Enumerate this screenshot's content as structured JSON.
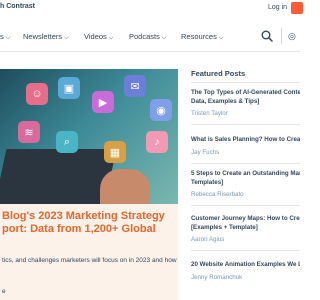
{
  "topbar": {
    "contrast_label": "h Contrast",
    "login_label": "Log in"
  },
  "nav": {
    "items": [
      {
        "label": "s"
      },
      {
        "label": "Newsletters"
      },
      {
        "label": "Videos"
      },
      {
        "label": "Podcasts"
      },
      {
        "label": "Resources"
      }
    ],
    "chevron": "⌵"
  },
  "article": {
    "title": "Blog's 2023 Marketing Strategy port: Data from 1,200+ Global",
    "description": "tics, and challenges marketers will focus on in 2023 and how",
    "more": "e"
  },
  "featured": {
    "heading": "Featured Posts",
    "posts": [
      {
        "title": "The Top Types of AI-Generated Conte",
        "title2": "Data, Examples & Tips]",
        "author": "Tristen Taylor"
      },
      {
        "title": "What is Sales Planning? How to Creat",
        "title2": "",
        "author": "Jay Fuchs"
      },
      {
        "title": "5 Steps to Create an Outstanding Mar",
        "title2": "Templates]",
        "author": "Rebecca Riserbato"
      },
      {
        "title": "Customer Journey Maps: How to Creat",
        "title2": "[Examples + Template]",
        "author": "Aaron Agius"
      },
      {
        "title": "20 Website Animation Examples We Lo",
        "title2": "",
        "author": "Jenny Romanchuk"
      }
    ]
  },
  "icons": {
    "search": "search-icon",
    "globe": "globe-icon"
  },
  "colors": {
    "accent": "#ff5c35",
    "article_title": "#e6662b",
    "article_bg": "#fdf2ea",
    "text": "#33475b",
    "author": "#7c98b6"
  }
}
